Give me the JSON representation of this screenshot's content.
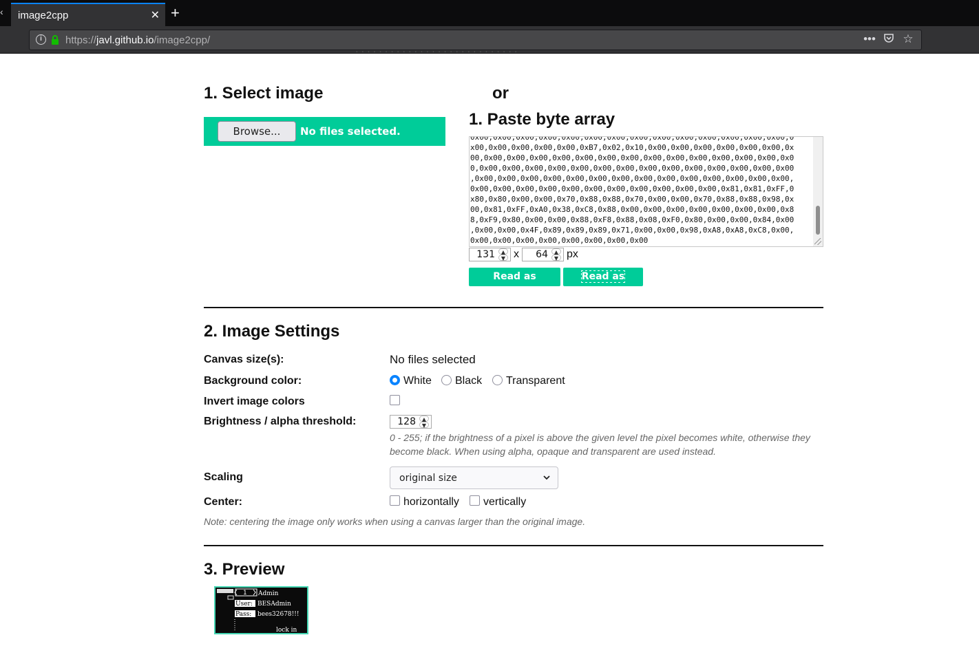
{
  "browser": {
    "tab_title": "image2cpp",
    "tab_close": "✕",
    "new_tab": "+",
    "url_scheme": "https://",
    "url_host": "javl.github.io",
    "url_path": "/image2cpp/",
    "page_actions": [
      "•••",
      "pocket",
      "star"
    ]
  },
  "section1": {
    "title_select": "1. Select image",
    "or_label": "or",
    "title_paste": "1. Paste byte array",
    "browse_label": "Browse...",
    "upload_status": "No files selected.",
    "byte_array_lines": [
      "0x00,0x00,0x00,0x00,0x00,0x00,0x00,0x00,0x00,0x00,0x00,0x00,0x00,0x00,0",
      "x00,0x00,0x00,0x00,0x00,0xB7,0x02,0x10,0x00,0x00,0x00,0x00,0x00,0x00,0x",
      "00,0x00,0x00,0x00,0x00,0x00,0x00,0x00,0x00,0x00,0x00,0x00,0x00,0x00,0x0",
      "0,0x00,0x00,0x00,0x00,0x00,0x00,0x00,0x00,0x00,0x00,0x00,0x00,0x00,0x00",
      ",0x00,0x00,0x00,0x00,0x00,0x00,0x00,0x00,0x00,0x00,0x00,0x00,0x00,0x00,",
      "0x00,0x00,0x00,0x00,0x00,0x00,0x00,0x00,0x00,0x00,0x00,0x81,0x81,0xFF,0",
      "x80,0x80,0x00,0x00,0x70,0x88,0x88,0x70,0x00,0x00,0x70,0x88,0x88,0x98,0x",
      "00,0x81,0xFF,0xA0,0x38,0xC8,0x88,0x00,0x00,0x00,0x00,0x00,0x00,0x00,0x8",
      "8,0xF9,0x80,0x00,0x00,0x88,0xF8,0x88,0x08,0xF0,0x80,0x00,0x00,0x84,0x00",
      ",0x00,0x00,0x4F,0x89,0x89,0x89,0x71,0x00,0x00,0x98,0xA8,0xA8,0xC8,0x00,",
      "0x00,0x00,0x00,0x00,0x00,0x00,0x00,0x00"
    ],
    "width_value": "131",
    "height_value": "64",
    "dim_separator": "x",
    "dim_unit": "px",
    "read_horizontal": "Read as horizontal",
    "read_vertical": "Read as vertical"
  },
  "section2": {
    "title": "2. Image Settings",
    "canvas_label": "Canvas size(s):",
    "canvas_value": "No files selected",
    "bg_label": "Background color:",
    "bg_options": [
      {
        "label": "White",
        "checked": true
      },
      {
        "label": "Black",
        "checked": false
      },
      {
        "label": "Transparent",
        "checked": false
      }
    ],
    "invert_label": "Invert image colors",
    "invert_checked": false,
    "threshold_label": "Brightness / alpha threshold:",
    "threshold_value": "128",
    "threshold_help_1": "0 - 255; if the brightness of a pixel is above the given level the pixel becomes white, otherwise they",
    "threshold_help_2": "become black. When using alpha, opaque and transparent are used instead.",
    "scaling_label": "Scaling",
    "scaling_value": "original size",
    "center_label": "Center:",
    "center_horizontal": "horizontally",
    "center_vertical": "vertically",
    "center_note": "Note: centering the image only works when using a canvas larger than the original image."
  },
  "section3": {
    "title": "3. Preview",
    "preview_text": {
      "page": "1",
      "title": "Admin",
      "user_label": "User:",
      "user_value": "BESAdmin",
      "pass_label": "Pass:",
      "pass_value": "bees32678!!!",
      "action": "lock in"
    }
  },
  "colors": {
    "accent": "#00cc99",
    "tab_highlight": "#0a84ff",
    "chrome_dark": "#0c0c0d",
    "chrome_bar": "#323234"
  }
}
